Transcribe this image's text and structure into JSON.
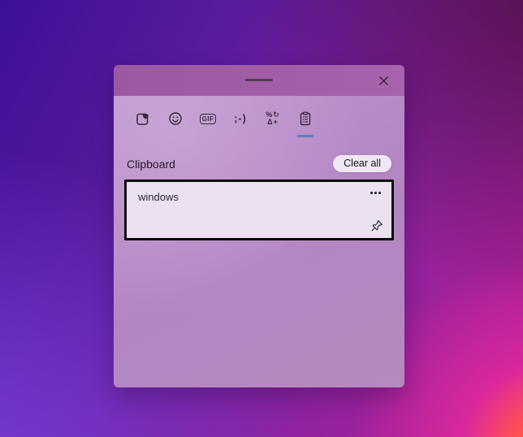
{
  "panel": {
    "accent_underline_color": "#5b7fc0",
    "tabs": [
      {
        "id": "recent",
        "icon": "heart-square-icon"
      },
      {
        "id": "emoji",
        "icon": "smiley-icon"
      },
      {
        "id": "gif",
        "icon": "gif-icon",
        "label": "GIF"
      },
      {
        "id": "kaomoji",
        "icon": "kaomoji-icon",
        "label": ";-)"
      },
      {
        "id": "symbols",
        "icon": "symbols-icon",
        "label_line1": "%↻",
        "label_line2": "Δ+"
      },
      {
        "id": "clipboard",
        "icon": "clipboard-icon",
        "selected": true
      }
    ],
    "header": {
      "title": "Clipboard",
      "clear_button": "Clear all"
    },
    "items": [
      {
        "text": "windows"
      }
    ]
  }
}
